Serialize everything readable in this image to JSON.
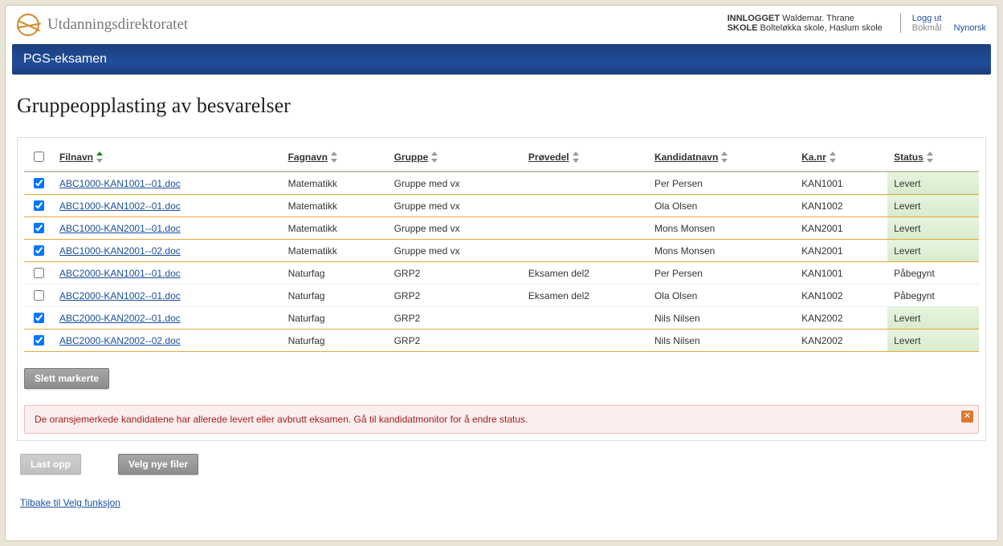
{
  "brand": "Utdanningsdirektoratet",
  "user": {
    "logged_in_label": "INNLOGGET",
    "name": "Waldemar. Thrane",
    "school_label": "SKOLE",
    "school": "Bolteløkka skole, Haslum skole"
  },
  "links": {
    "logout": "Logg ut",
    "lang_current": "Bokmål",
    "lang_other": "Nynorsk"
  },
  "app_title": "PGS-eksamen",
  "page_heading": "Gruppeopplasting av besvarelser",
  "columns": {
    "filename": "Filnavn",
    "subject": "Fagnavn",
    "group": "Gruppe",
    "part": "Prøvedel",
    "candidate": "Kandidatnavn",
    "candno": "Ka.nr",
    "status": "Status"
  },
  "rows": [
    {
      "checked": true,
      "orange": true,
      "file": "ABC1000-KAN1001--01.doc",
      "subject": "Matematikk",
      "group": "Gruppe med vx",
      "part": "",
      "candidate": "Per Persen",
      "candno": "KAN1001",
      "status": "Levert"
    },
    {
      "checked": true,
      "orange": true,
      "file": "ABC1000-KAN1002--01.doc",
      "subject": "Matematikk",
      "group": "Gruppe med vx",
      "part": "",
      "candidate": "Ola Olsen",
      "candno": "KAN1002",
      "status": "Levert"
    },
    {
      "checked": true,
      "orange": true,
      "file": "ABC1000-KAN2001--01.doc",
      "subject": "Matematikk",
      "group": "Gruppe med vx",
      "part": "",
      "candidate": "Mons Monsen",
      "candno": "KAN2001",
      "status": "Levert"
    },
    {
      "checked": true,
      "orange": true,
      "file": "ABC1000-KAN2001--02.doc",
      "subject": "Matematikk",
      "group": "Gruppe med vx",
      "part": "",
      "candidate": "Mons Monsen",
      "candno": "KAN2001",
      "status": "Levert"
    },
    {
      "checked": false,
      "orange": false,
      "file": "ABC2000-KAN1001--01.doc",
      "subject": "Naturfag",
      "group": "GRP2",
      "part": "Eksamen del2",
      "candidate": "Per Persen",
      "candno": "KAN1001",
      "status": "Påbegynt"
    },
    {
      "checked": false,
      "orange": false,
      "file": "ABC2000-KAN1002--01.doc",
      "subject": "Naturfag",
      "group": "GRP2",
      "part": "Eksamen del2",
      "candidate": "Ola Olsen",
      "candno": "KAN1002",
      "status": "Påbegynt"
    },
    {
      "checked": true,
      "orange": true,
      "file": "ABC2000-KAN2002--01.doc",
      "subject": "Naturfag",
      "group": "GRP2",
      "part": "",
      "candidate": "Nils Nilsen",
      "candno": "KAN2002",
      "status": "Levert"
    },
    {
      "checked": true,
      "orange": true,
      "file": "ABC2000-KAN2002--02.doc",
      "subject": "Naturfag",
      "group": "GRP2",
      "part": "",
      "candidate": "Nils Nilsen",
      "candno": "KAN2002",
      "status": "Levert"
    }
  ],
  "buttons": {
    "delete_selected": "Slett markerte",
    "upload": "Last opp",
    "choose_new": "Velg nye filer"
  },
  "alert": {
    "text": "De oransjemerkede kandidatene har allerede levert eller avbrutt eksamen. Gå til kandidatmonitor for å endre status.",
    "close": "✕"
  },
  "back_link": "Tilbake til Velg funksjon"
}
